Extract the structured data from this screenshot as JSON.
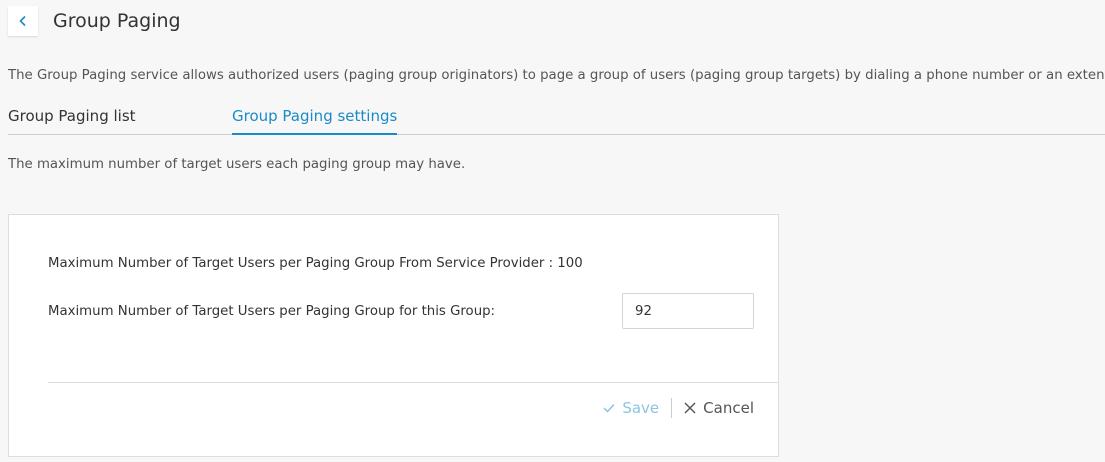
{
  "header": {
    "back_icon": "chevron-left-icon",
    "title": "Group Paging"
  },
  "description": "The Group Paging service allows authorized users (paging group originators) to page a group of users (paging group targets) by dialing a phone number or an extension.",
  "tabs": [
    {
      "label": "Group Paging list",
      "active": false
    },
    {
      "label": "Group Paging settings",
      "active": true
    }
  ],
  "section_description": "The maximum number of target users each paging group may have.",
  "settings": {
    "service_provider_label": "Maximum Number of Target Users per Paging Group From Service Provider : 100",
    "group_label": "Maximum Number of Target Users per Paging Group for this Group:",
    "group_value": "92"
  },
  "actions": {
    "save_label": "Save",
    "save_icon": "checkmark-icon",
    "cancel_label": "Cancel",
    "cancel_icon": "close-icon"
  },
  "colors": {
    "accent": "#1a8bc7",
    "save_disabled": "#8cc4e3",
    "background": "#f7f7f7"
  }
}
